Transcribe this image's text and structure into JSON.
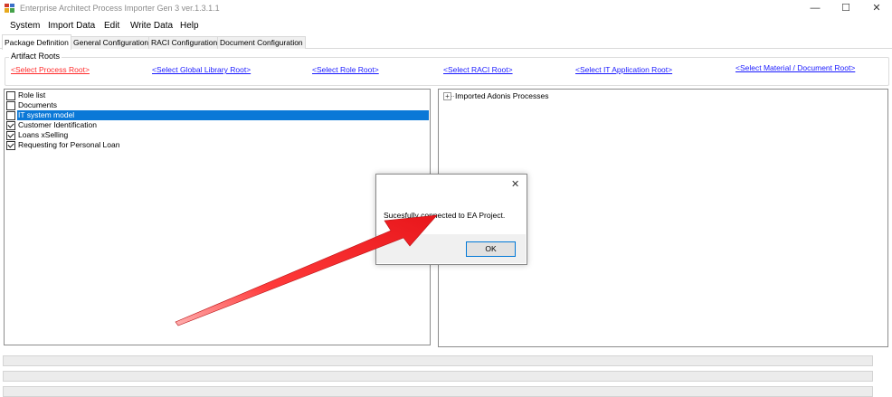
{
  "window": {
    "title": "Enterprise Architect Process Importer Gen 3 ver.1.3.1.1",
    "minimize_glyph": "—",
    "maximize_glyph": "☐",
    "close_glyph": "✕"
  },
  "menu": [
    "System",
    "Import Data",
    "Edit",
    "Write Data",
    "Help"
  ],
  "tabs": [
    "Package Definition",
    "General Configuration",
    "RACI Configuration",
    "Document Configuration"
  ],
  "active_tab": "Package Definition",
  "artifact_roots": {
    "legend": "Artifact Roots",
    "links": [
      "<Select Process Root>",
      "<Select Global Library Root>",
      "<Select Role Root>",
      "<Select RACI Root>",
      "<Select IT Application Root>",
      "<Select Material / Document Root>"
    ]
  },
  "left_list": [
    {
      "label": "Role list",
      "checked": false,
      "selected": false
    },
    {
      "label": "Documents",
      "checked": false,
      "selected": false
    },
    {
      "label": "IT system model",
      "checked": false,
      "selected": true
    },
    {
      "label": "Customer Identification",
      "checked": true,
      "selected": false
    },
    {
      "label": "Loans xSelling",
      "checked": true,
      "selected": false
    },
    {
      "label": "Requesting for Personal Loan",
      "checked": true,
      "selected": false
    }
  ],
  "right_tree": {
    "expander": "+",
    "root_label": "Imported Adonis Processes"
  },
  "dialog": {
    "message": "Sucesfully connected to EA Project.",
    "ok_label": "OK",
    "close_glyph": "✕"
  },
  "colors": {
    "selection": "#0a78d7",
    "arrow": "#e8161b",
    "link": "#1a1aff",
    "link_active": "#ff2b2b"
  }
}
